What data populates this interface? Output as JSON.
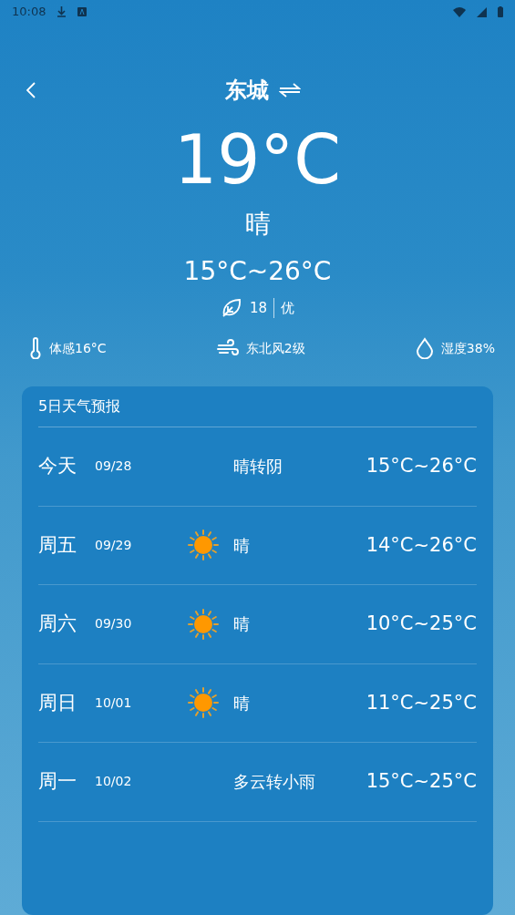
{
  "status_bar": {
    "time": "10:08"
  },
  "header": {
    "city": "东城"
  },
  "current": {
    "temperature": "19°C",
    "condition": "晴",
    "range": "15°C~26°C",
    "aqi_value": "18",
    "aqi_level": "优"
  },
  "details": [
    {
      "kind": "feels",
      "text": "体感16°C"
    },
    {
      "kind": "wind",
      "text": "东北风2级"
    },
    {
      "kind": "humidity",
      "text": "湿度38%"
    }
  ],
  "forecast": {
    "title": "5日天气预报",
    "days": [
      {
        "day": "今天",
        "date": "09/28",
        "kind": "plain",
        "condition": "晴转阴",
        "range": "15°C~26°C"
      },
      {
        "day": "周五",
        "date": "09/29",
        "kind": "sunny",
        "condition": "晴",
        "range": "14°C~26°C"
      },
      {
        "day": "周六",
        "date": "09/30",
        "kind": "sunny",
        "condition": "晴",
        "range": "10°C~25°C"
      },
      {
        "day": "周日",
        "date": "10/01",
        "kind": "sunny",
        "condition": "晴",
        "range": "11°C~25°C"
      },
      {
        "day": "周一",
        "date": "10/02",
        "kind": "plain",
        "condition": "多云转小雨",
        "range": "15°C~25°C"
      }
    ]
  }
}
